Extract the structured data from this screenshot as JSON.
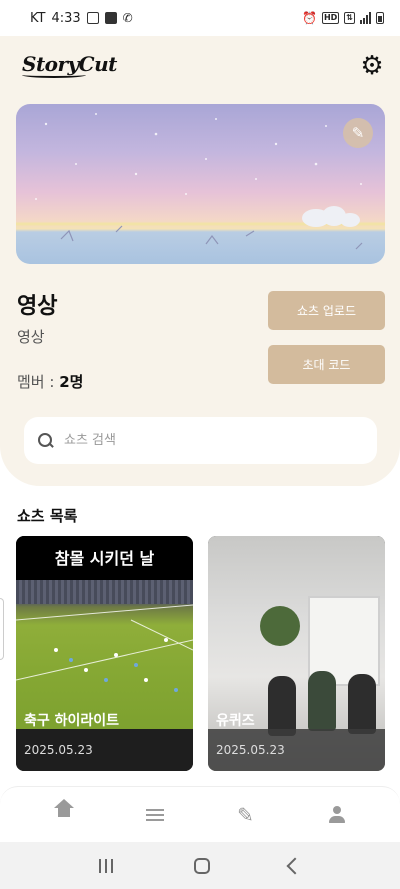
{
  "status_bar": {
    "carrier": "KT",
    "time": "4:33",
    "indicators": [
      "screenshot-icon",
      "maps-icon",
      "missed-call-icon"
    ],
    "right_icons": [
      "alarm-icon",
      "hd-icon",
      "lte-icon",
      "signal-icon",
      "battery-icon"
    ],
    "hd_label": "HD"
  },
  "header": {
    "logo_text": "StoryCut",
    "settings_icon": "gear-icon"
  },
  "banner": {
    "edit_icon": "pencil-icon"
  },
  "group": {
    "title": "영상",
    "subtitle": "영상",
    "member_label": "멤버 : ",
    "member_count": "2명"
  },
  "actions": {
    "upload_label": "쇼츠 업로드",
    "invite_label": "초대 코드"
  },
  "search": {
    "placeholder": "쇼츠 검색",
    "value": ""
  },
  "shorts": {
    "section_title": "쇼츠 목록",
    "items": [
      {
        "overlay_top": "참몰 시키던 날",
        "caption": "축구 하이라이트",
        "date": "2025.05.23"
      },
      {
        "caption": "유퀴즈",
        "date": "2025.05.23"
      }
    ]
  },
  "bottom_nav": {
    "items": [
      "home-icon",
      "list-icon",
      "pencil-icon",
      "user-icon"
    ]
  },
  "colors": {
    "cream_panel": "#f8f3ea",
    "accent_button": "#d3bb9d"
  }
}
